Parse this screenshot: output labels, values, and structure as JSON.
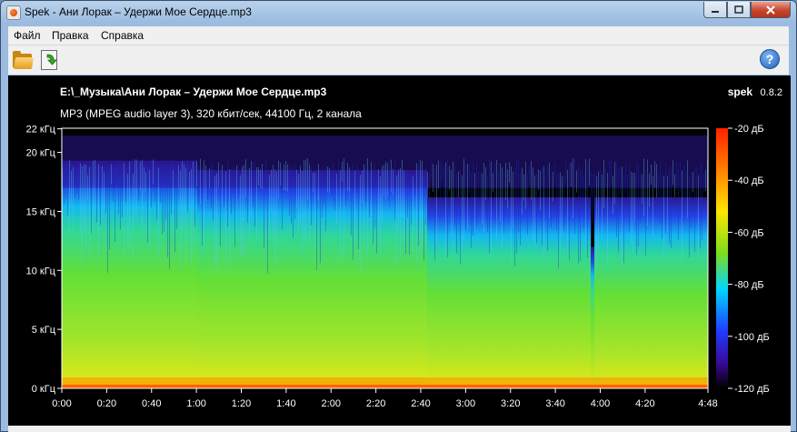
{
  "window": {
    "title": "Spek - Ани Лорак – Удержи Мое Сердце.mp3",
    "buttons": [
      "0",
      "1",
      "r"
    ]
  },
  "menu": [
    "Файл",
    "Правка",
    "Справка"
  ],
  "toolbar": {
    "open_icon": "folder-open-icon",
    "save_icon": "save-icon",
    "help_icon": "help-icon",
    "help_label": "?"
  },
  "spectrum": {
    "file_path": "E:\\_Музыка\\Ани Лорак – Удержи Мое Сердце.mp3",
    "file_info": "MP3 (MPEG audio layer 3), 320 кбит/сек, 44100 Гц, 2 канала",
    "app_name": "spek",
    "app_version": "0.8.2",
    "y_ticks": [
      "22 кГц",
      "20 кГц",
      "15 кГц",
      "10 кГц",
      "5 кГц",
      "0 кГц"
    ],
    "x_ticks": [
      "0:00",
      "0:20",
      "0:40",
      "1:00",
      "1:20",
      "1:40",
      "2:00",
      "2:20",
      "2:40",
      "3:00",
      "3:20",
      "3:40",
      "4:00",
      "4:20",
      "4:48"
    ],
    "db_ticks": [
      "-20 дБ",
      "-40 дБ",
      "-60 дБ",
      "-80 дБ",
      "-100 дБ",
      "-120 дБ"
    ]
  }
}
